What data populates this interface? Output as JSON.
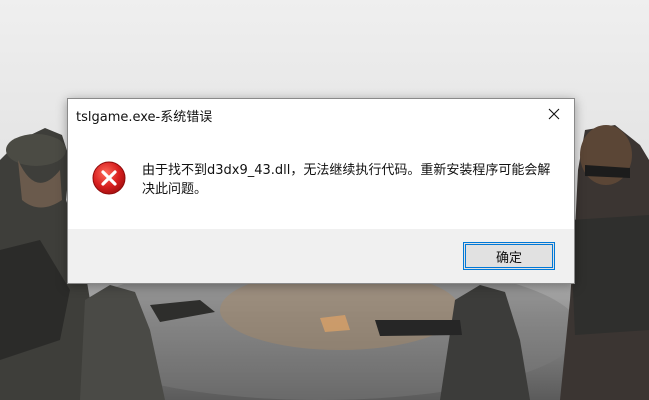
{
  "dialog": {
    "title": "tslgame.exe-系统错误",
    "message": "由于找不到d3dx9_43.dll，无法继续执行代码。重新安装程序可能会解决此问题。",
    "ok_label": "确定",
    "close_icon": "close-icon",
    "error_icon": "error-icon"
  },
  "colors": {
    "button_focus": "#0078d7",
    "error_red": "#d71f1f",
    "footer_bg": "#f0f0f0"
  }
}
